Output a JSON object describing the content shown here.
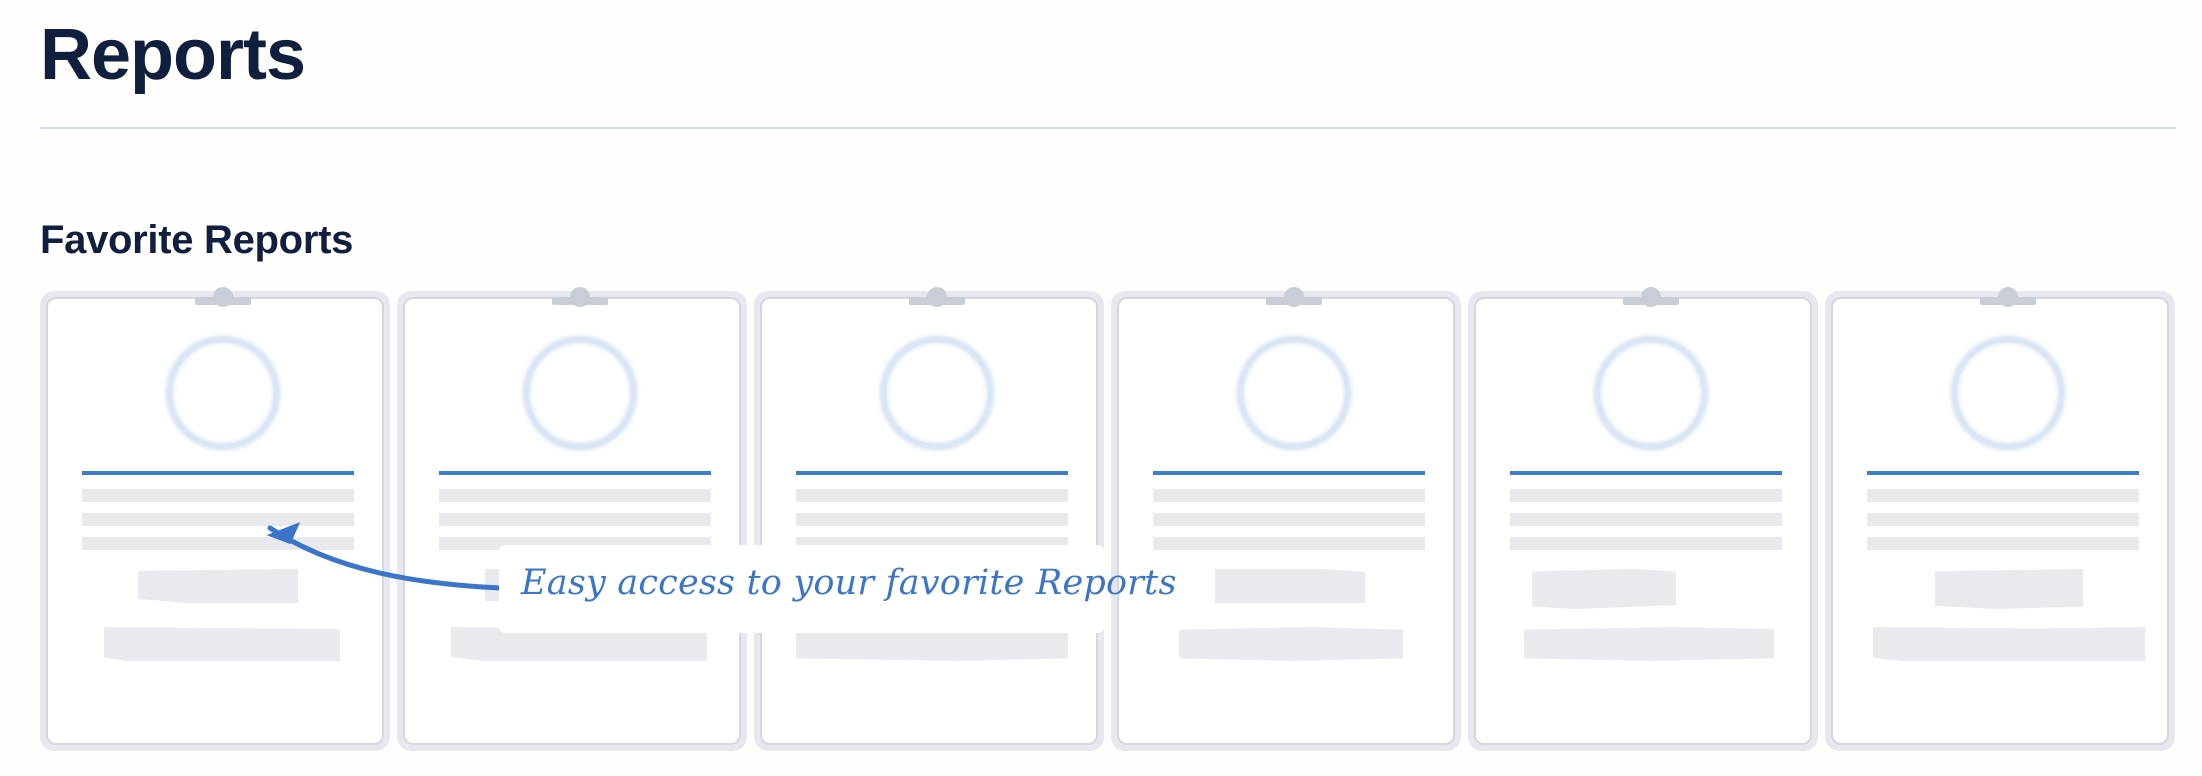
{
  "page": {
    "title": "Reports"
  },
  "favorites": {
    "section_title": "Favorite Reports",
    "card_count": 6
  },
  "callout": {
    "text": "Easy access to your favorite Reports",
    "color": "#3a75c9"
  },
  "colors": {
    "title_text": "#0f1f3d",
    "accent_line": "#3c7dd0",
    "divider": "#d3d9ea",
    "placeholder_gray": "#e8e9ec"
  }
}
